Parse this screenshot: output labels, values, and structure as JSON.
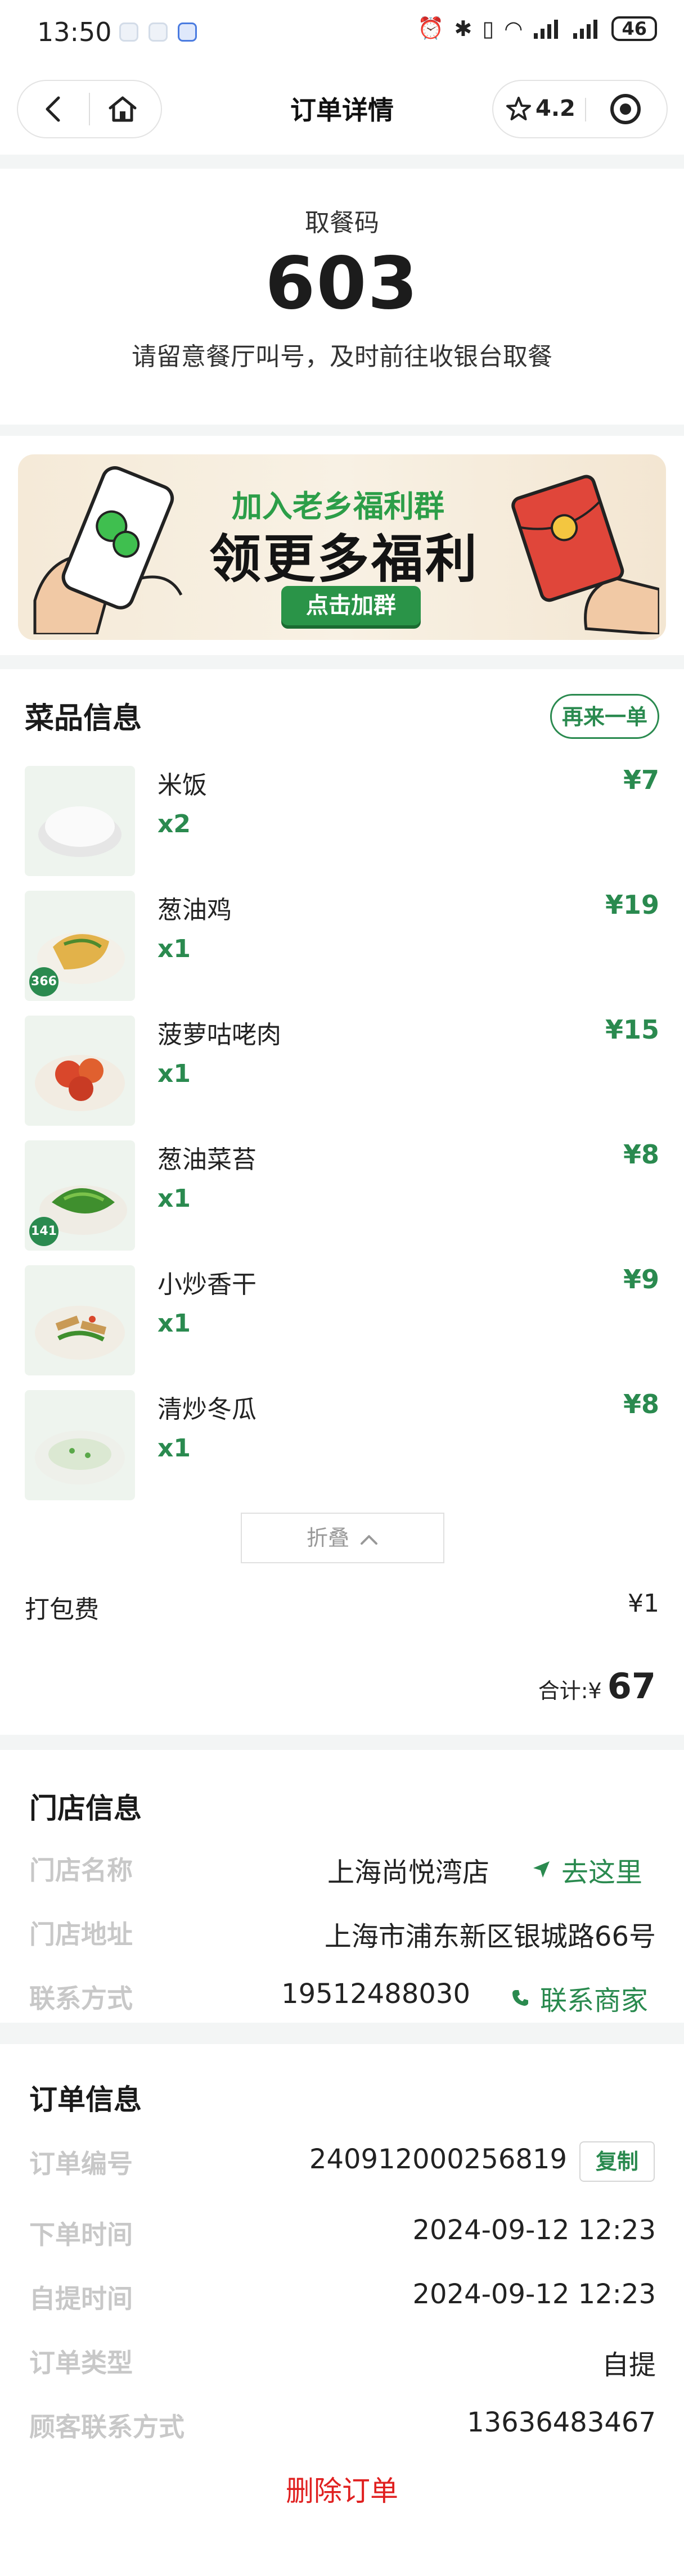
{
  "status_bar": {
    "time": "13:50",
    "battery": "46"
  },
  "nav": {
    "title": "订单详情",
    "rating": "4.2"
  },
  "pickup": {
    "label": "取餐码",
    "code": "603",
    "tip": "请留意餐厅叫号，及时前往收银台取餐"
  },
  "banner": {
    "line1": "加入老乡福利群",
    "line2": "领更多福利",
    "button": "点击加群"
  },
  "dishes": {
    "title": "菜品信息",
    "reorder": "再来一单",
    "items": [
      {
        "name": "米饭",
        "qty": "x2",
        "price": "¥7",
        "badge": ""
      },
      {
        "name": "葱油鸡",
        "qty": "x1",
        "price": "¥19",
        "badge": "366"
      },
      {
        "name": "菠萝咕咾肉",
        "qty": "x1",
        "price": "¥15",
        "badge": ""
      },
      {
        "name": "葱油菜苔",
        "qty": "x1",
        "price": "¥8",
        "badge": "141"
      },
      {
        "name": "小炒香干",
        "qty": "x1",
        "price": "¥9",
        "badge": ""
      },
      {
        "name": "清炒冬瓜",
        "qty": "x1",
        "price": "¥8",
        "badge": ""
      }
    ],
    "fold": "折叠",
    "packing_label": "打包费",
    "packing_value": "¥1",
    "total_label": "合计:¥",
    "total_value": "67"
  },
  "store": {
    "title": "门店信息",
    "name_label": "门店名称",
    "name": "上海尚悦湾店",
    "nav_link": "去这里",
    "address_label": "门店地址",
    "address": "上海市浦东新区银城路66号",
    "contact_label": "联系方式",
    "phone": "19512488030",
    "contact_link": "联系商家"
  },
  "order": {
    "title": "订单信息",
    "number_label": "订单编号",
    "number": "240912000256819",
    "copy": "复制",
    "order_time_label": "下单时间",
    "order_time": "2024-09-12 12:23",
    "pickup_time_label": "自提时间",
    "pickup_time": "2024-09-12 12:23",
    "type_label": "订单类型",
    "type": "自提",
    "customer_label": "顾客联系方式",
    "customer_phone": "13636483467",
    "delete": "删除订单"
  }
}
